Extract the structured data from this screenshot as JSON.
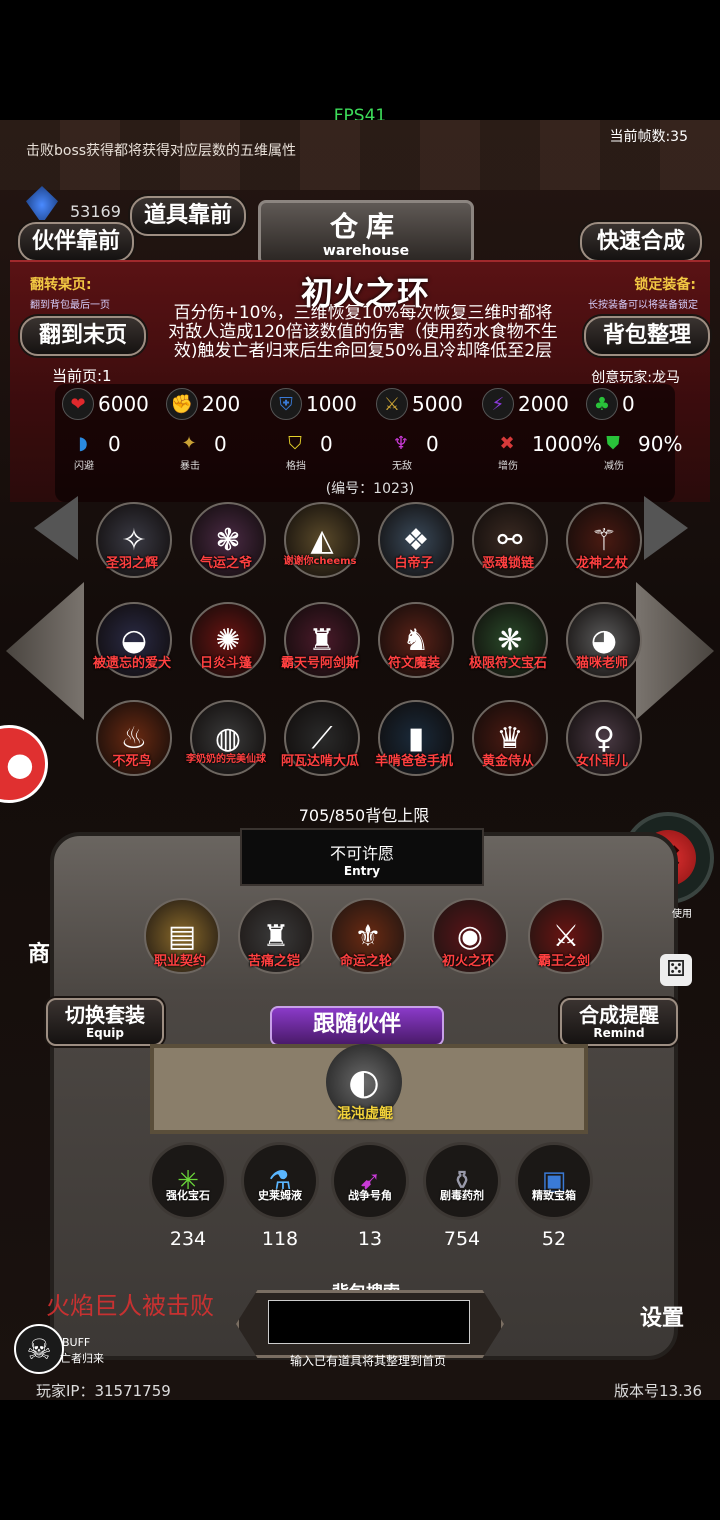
{
  "fps": "FPS41",
  "top": {
    "boss_tip": "击败boss获得都将获得对应层数的五维属性",
    "frame_rate": "当前帧数:35",
    "currency_value": "53169"
  },
  "buttons": {
    "item_front": "道具靠前",
    "partner_front": "伙伴靠前",
    "quick_synth": "快速合成",
    "goto_last": "翻到末页",
    "bag_sort": "背包整理",
    "switch_set": "切换套装",
    "switch_set_en": "Equip",
    "synth_remind": "合成提醒",
    "synth_remind_en": "Remind",
    "follow_partner": "跟随伙伴",
    "settings": "设置",
    "shop": "商"
  },
  "warehouse": {
    "title": "仓库",
    "subtitle": "warehouse"
  },
  "labels": {
    "flip_page": "翻转某页:",
    "flip_hint": "翻到背包最后一页",
    "lock_equip": "锁定装备:",
    "lock_hint": "长按装备可以将装备锁定",
    "current_page": "当前页:1",
    "creator": "创意玩家:龙马",
    "item_number": "(编号：1023)",
    "bag_limit": "705/850背包上限",
    "wish": "不可许愿",
    "wish_en": "Entry",
    "search_title": "背包搜索",
    "search_hint": "输入已有道具将其整理到首页",
    "buff": "BUFF",
    "buff_name": "亡者归来",
    "player_ip": "玩家IP：31571759",
    "version": "版本号13.36",
    "kill_log": "火焰巨人被击败",
    "dice_hint": "使用"
  },
  "detail": {
    "name": "初火之环",
    "description": "百分伤+10%，三维恢复10%每次恢复三维时都将对敌人造成120倍该数值的伤害（使用药水食物不生效)触发亡者归来后生命回复50%且冷却降低至2层"
  },
  "stats_row1": [
    {
      "icon": "heart-icon",
      "glyph": "❤",
      "color": "#e0282c",
      "value": "6000"
    },
    {
      "icon": "strength-icon",
      "glyph": "✊",
      "color": "#e6c22a",
      "value": "200"
    },
    {
      "icon": "defense-icon",
      "glyph": "⛨",
      "color": "#3a7ad6",
      "value": "1000"
    },
    {
      "icon": "attack-icon",
      "glyph": "⚔",
      "color": "#c9a235",
      "value": "5000"
    },
    {
      "icon": "speed-icon",
      "glyph": "⚡",
      "color": "#8a3adc",
      "value": "2000"
    },
    {
      "icon": "luck-icon",
      "glyph": "♣",
      "color": "#29c23a",
      "value": "0"
    }
  ],
  "stats_row2": [
    {
      "icon": "dodge-icon",
      "glyph": "◗",
      "color": "#2a8ae0",
      "label": "闪避",
      "value": "0"
    },
    {
      "icon": "crit-icon",
      "glyph": "✦",
      "color": "#c9a235",
      "label": "暴击",
      "value": "0"
    },
    {
      "icon": "block-icon",
      "glyph": "⛉",
      "color": "#e6d22a",
      "label": "格挡",
      "value": "0"
    },
    {
      "icon": "invincible-icon",
      "glyph": "♆",
      "color": "#c83ad6",
      "label": "无敌",
      "value": "0"
    },
    {
      "icon": "damage-up-icon",
      "glyph": "✖",
      "color": "#d63a3a",
      "label": "增伤",
      "value": "1000%"
    },
    {
      "icon": "damage-down-icon",
      "glyph": "⛊",
      "color": "#29c23a",
      "label": "减伤",
      "value": "90%"
    }
  ],
  "items": [
    {
      "name": "圣羽之辉",
      "glyph": "✧",
      "bg": "#3a3a44"
    },
    {
      "name": "气运之爷",
      "glyph": "❃",
      "bg": "#4a2a44"
    },
    {
      "name": "谢谢你cheems",
      "glyph": "◭",
      "bg": "#5a4a2a"
    },
    {
      "name": "白帝子",
      "glyph": "❖",
      "bg": "#3a4a5a"
    },
    {
      "name": "恶魂锁链",
      "glyph": "⚯",
      "bg": "#3a2a22"
    },
    {
      "name": "龙神之杖",
      "glyph": "⚚",
      "bg": "#4a1a12"
    },
    {
      "name": "被遗忘的爱犬",
      "glyph": "◒",
      "bg": "#2a2a44"
    },
    {
      "name": "日炎斗篷",
      "glyph": "✺",
      "bg": "#6a1412"
    },
    {
      "name": "霸天号阿剑斯",
      "glyph": "♜",
      "bg": "#4a1a2a"
    },
    {
      "name": "符文魔装",
      "glyph": "♞",
      "bg": "#5a2218"
    },
    {
      "name": "极限符文宝石",
      "glyph": "❋",
      "bg": "#2a4a2a"
    },
    {
      "name": "猫咪老师",
      "glyph": "◕",
      "bg": "#5a5a5a"
    },
    {
      "name": "不死鸟",
      "glyph": "♨",
      "bg": "#6a2a12"
    },
    {
      "name": "李奶奶的完美仙球",
      "glyph": "◍",
      "bg": "#3a3a3a"
    },
    {
      "name": "阿瓦达啃大瓜",
      "glyph": "⟋",
      "bg": "#2a2a2a"
    },
    {
      "name": "羊啃爸爸手机",
      "glyph": "▮",
      "bg": "#1a2a3a"
    },
    {
      "name": "黄金侍从",
      "glyph": "♛",
      "bg": "#4a1a12"
    },
    {
      "name": "女仆菲儿",
      "glyph": "♀",
      "bg": "#4a3a44"
    }
  ],
  "equipped": [
    {
      "name": "职业契约",
      "glyph": "▤",
      "bg": "#8a6a2a"
    },
    {
      "name": "苦痛之铠",
      "glyph": "♜",
      "bg": "#3a3a3a"
    },
    {
      "name": "命运之轮",
      "glyph": "⚜",
      "bg": "#6a2a12"
    },
    {
      "name": "初火之环",
      "glyph": "◉",
      "bg": "#5a1418"
    },
    {
      "name": "霸王之剑",
      "glyph": "⚔",
      "bg": "#6a1412"
    }
  ],
  "partner": {
    "name": "混沌虚鲲",
    "glyph": "◐"
  },
  "resources": [
    {
      "name": "强化宝石",
      "glyph": "✳",
      "count": "234",
      "color": "#6ad63a"
    },
    {
      "name": "史莱姆液",
      "glyph": "⚗",
      "count": "118",
      "color": "#5ab6ff"
    },
    {
      "name": "战争号角",
      "glyph": "➹",
      "count": "13",
      "color": "#c83ad6"
    },
    {
      "name": "剧毒药剂",
      "glyph": "⚱",
      "count": "754",
      "color": "#9a9aaa"
    },
    {
      "name": "精致宝箱",
      "glyph": "▣",
      "count": "52",
      "color": "#3a7ad6"
    }
  ]
}
